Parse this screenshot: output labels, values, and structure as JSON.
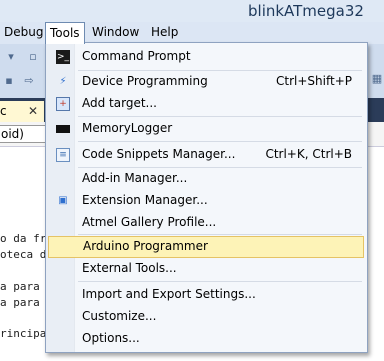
{
  "window": {
    "title": "blinkATmega32"
  },
  "menubar": {
    "items": [
      "Debug",
      "Tools",
      "Window",
      "Help"
    ],
    "active": "Tools"
  },
  "tab": {
    "label": "c",
    "close": "✕"
  },
  "navbar": {
    "value": "oid)"
  },
  "editor": {
    "lines": [
      "o da fr",
      "oteca d",
      "a para",
      "a para",
      "rincipa"
    ]
  },
  "tools_menu": {
    "items": [
      {
        "label": "Command Prompt",
        "shortcut": "",
        "icon": "command-prompt-icon"
      },
      {
        "label": "Device Programming",
        "shortcut": "Ctrl+Shift+P",
        "icon": "device-programming-icon"
      },
      {
        "label": "Add target...",
        "shortcut": "",
        "icon": "add-target-icon"
      },
      {
        "label": "MemoryLogger",
        "shortcut": "",
        "icon": "chip-icon"
      },
      {
        "label": "Code Snippets Manager...",
        "shortcut": "Ctrl+K, Ctrl+B",
        "icon": "code-snippets-icon"
      },
      {
        "label": "Add-in Manager...",
        "shortcut": "",
        "icon": ""
      },
      {
        "label": "Extension Manager...",
        "shortcut": "",
        "icon": "extension-manager-icon"
      },
      {
        "label": "Atmel Gallery Profile...",
        "shortcut": "",
        "icon": ""
      },
      {
        "label": "Arduino Programmer",
        "shortcut": "",
        "icon": ""
      },
      {
        "label": "External Tools...",
        "shortcut": "",
        "icon": ""
      },
      {
        "label": "Import and Export Settings...",
        "shortcut": "",
        "icon": ""
      },
      {
        "label": "Customize...",
        "shortcut": "",
        "icon": ""
      },
      {
        "label": "Options...",
        "shortcut": "",
        "icon": ""
      }
    ],
    "highlighted": "Arduino Programmer"
  }
}
